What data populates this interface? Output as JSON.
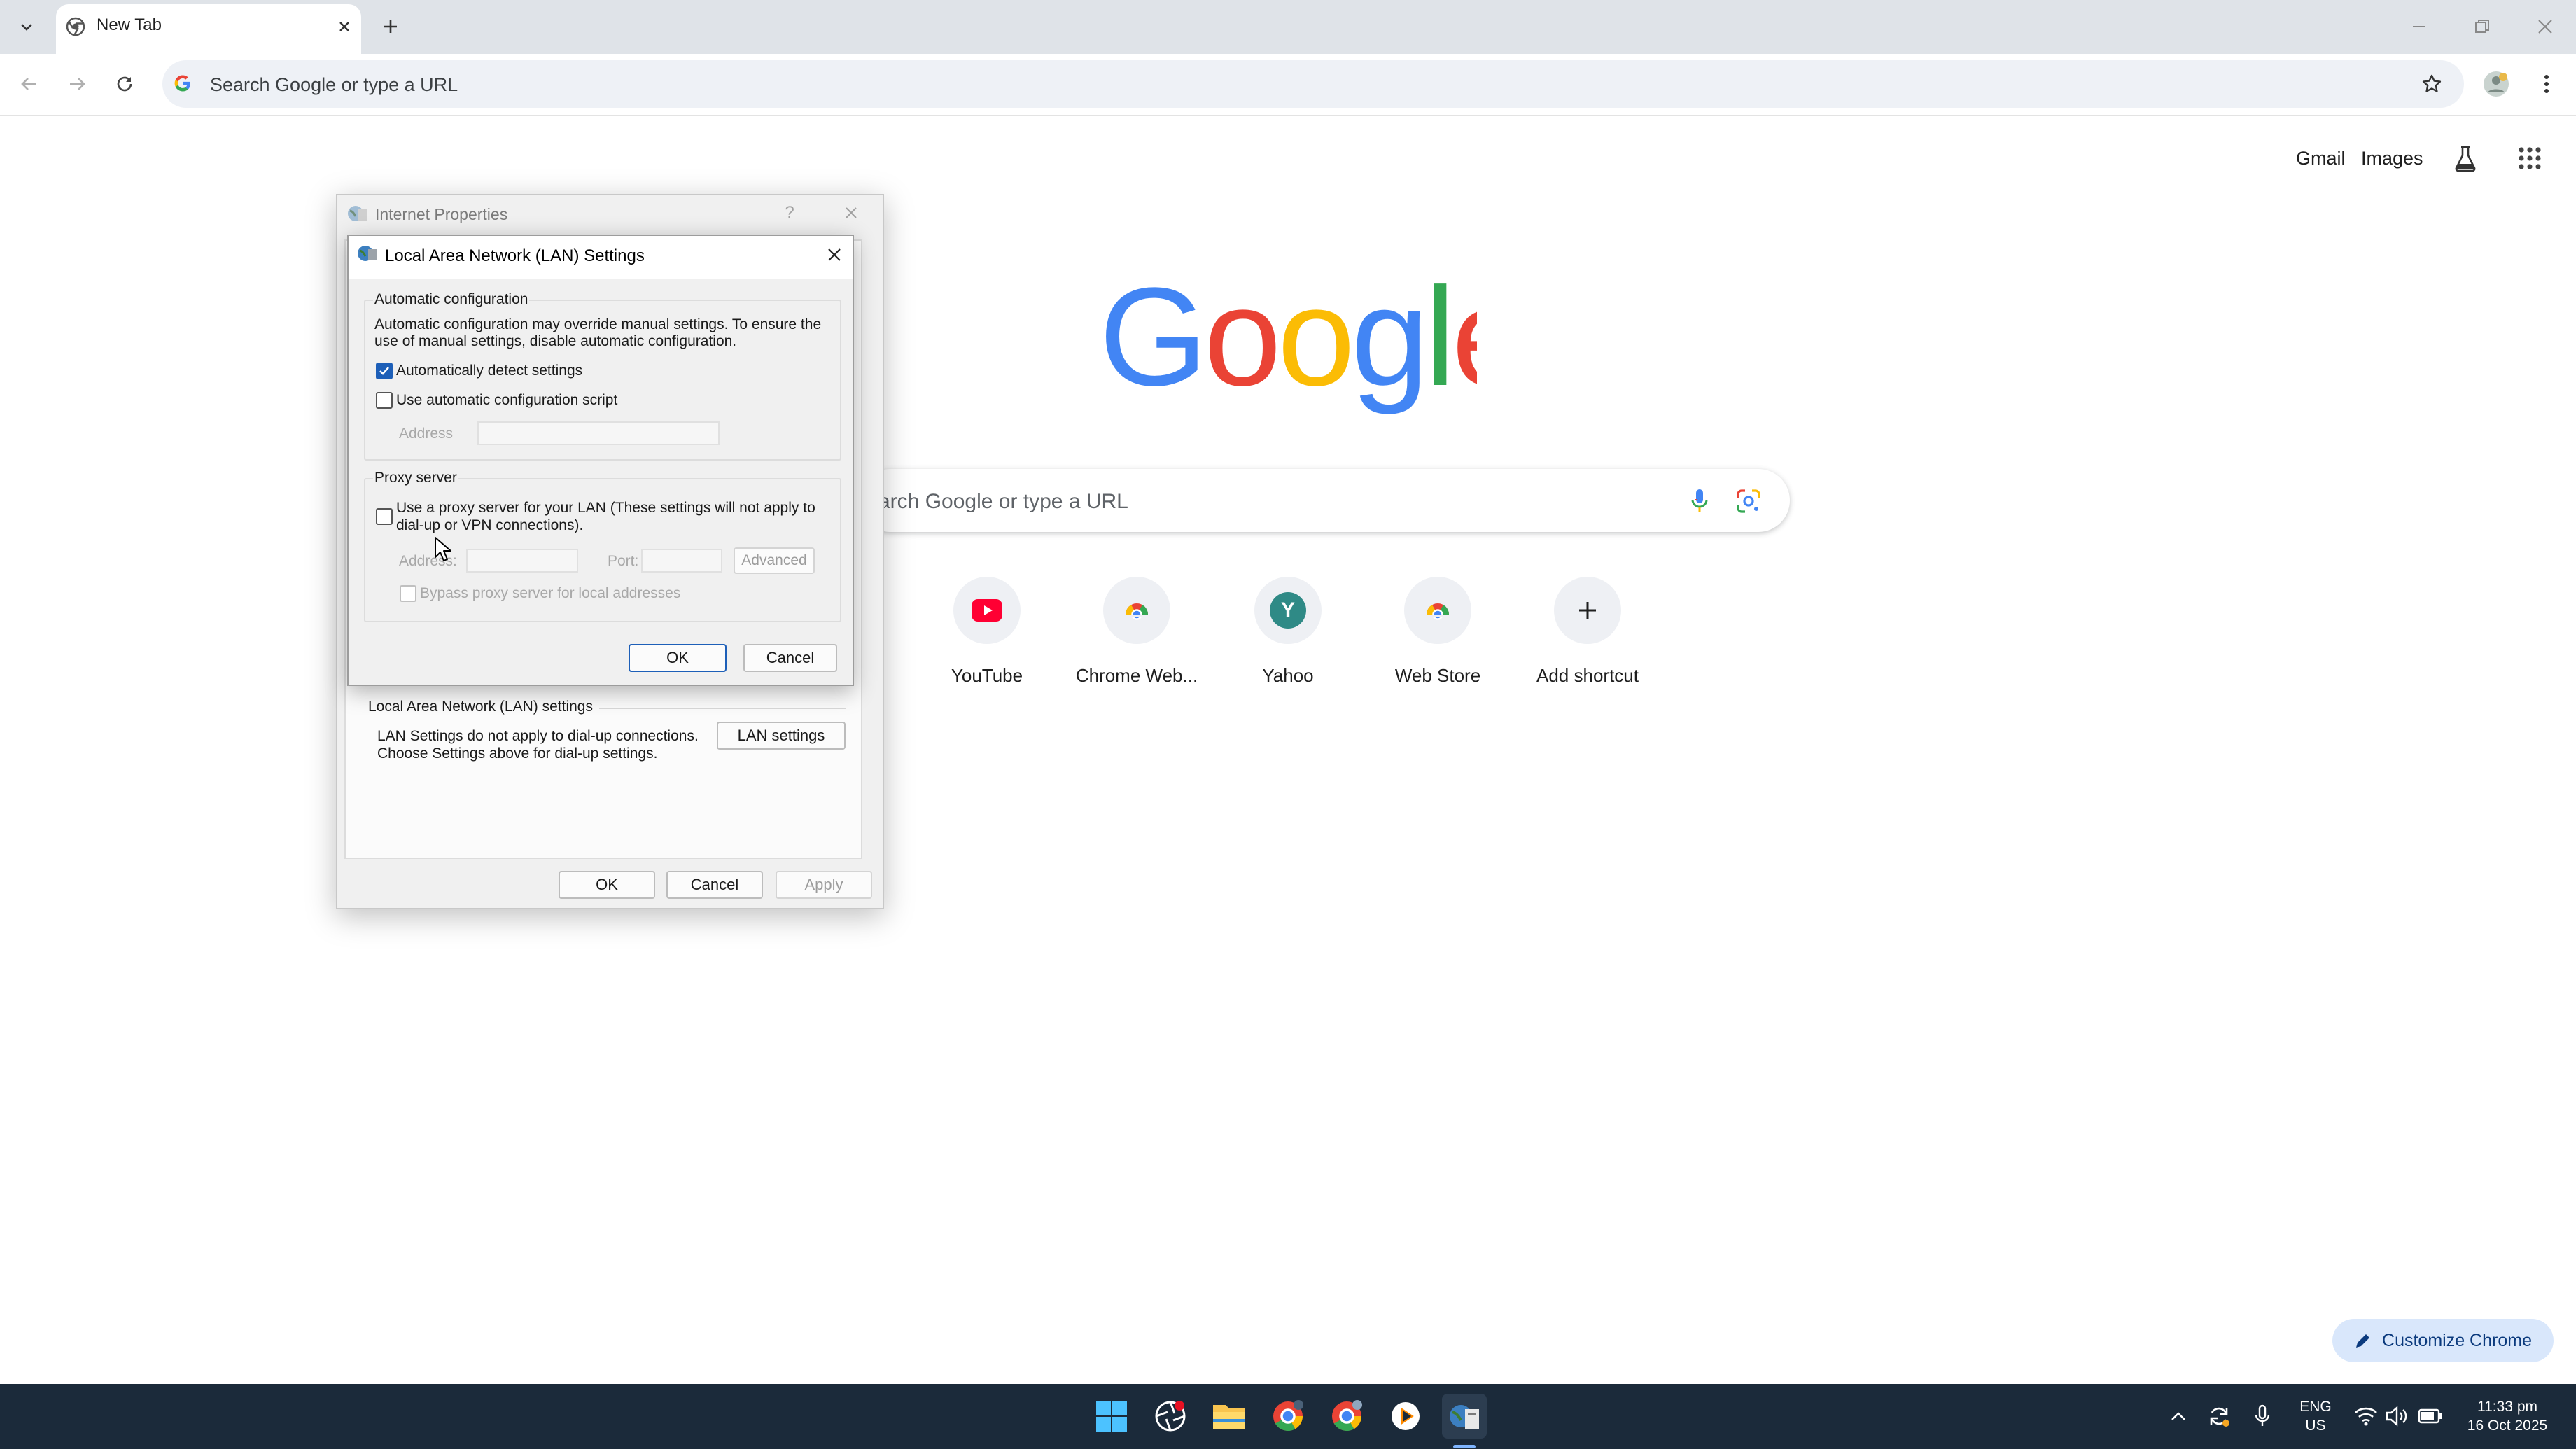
{
  "browser": {
    "tab_title": "New Tab",
    "omnibox_placeholder": "Search Google or type a URL"
  },
  "ntp": {
    "links": {
      "gmail": "Gmail",
      "images": "Images"
    },
    "logo": "Google",
    "search_placeholder": "arch Google or type a URL",
    "shortcuts": [
      {
        "label": "YouTube",
        "icon": "youtube-icon"
      },
      {
        "label": "Chrome Web...",
        "icon": "chrome-web-store-icon"
      },
      {
        "label": "Yahoo",
        "icon": "yahoo-icon",
        "letter": "Y"
      },
      {
        "label": "Web Store",
        "icon": "web-store-icon"
      },
      {
        "label": "Add shortcut",
        "icon": "plus-icon"
      }
    ],
    "customize_label": "Customize Chrome"
  },
  "internet_properties": {
    "title": "Internet Properties",
    "lan_section_title": "Local Area Network (LAN) settings",
    "lan_note_line1": "LAN Settings do not apply to dial-up connections.",
    "lan_note_line2": "Choose Settings above for dial-up settings.",
    "lan_settings_button": "LAN settings",
    "ok": "OK",
    "cancel": "Cancel",
    "apply": "Apply"
  },
  "lan_dialog": {
    "title": "Local Area Network (LAN) Settings",
    "auto_config": {
      "heading": "Automatic configuration",
      "desc_line1": "Automatic configuration may override manual settings.  To ensure the",
      "desc_line2": "use of manual settings, disable automatic configuration.",
      "auto_detect_label": "Automatically detect settings",
      "auto_detect_checked": true,
      "use_script_label": "Use automatic configuration script",
      "use_script_checked": false,
      "address_label": "Address"
    },
    "proxy": {
      "heading": "Proxy server",
      "use_proxy_line1": "Use a proxy server for your LAN (These settings will not apply to",
      "use_proxy_line2": "dial-up or VPN connections).",
      "use_proxy_checked": false,
      "address_label": "Address:",
      "port_label": "Port:",
      "advanced_button": "Advanced",
      "bypass_label": "Bypass proxy server for local addresses",
      "bypass_checked": false
    },
    "ok": "OK",
    "cancel": "Cancel"
  },
  "taskbar": {
    "lang_line1": "ENG",
    "lang_line2": "US",
    "time": "11:33 pm",
    "date": "16 Oct 2025"
  },
  "colors": {
    "google_blue": "#4285F4",
    "google_red": "#EA4335",
    "google_yellow": "#FBBC05",
    "google_green": "#34A853",
    "taskbar": "#1b2a3a",
    "accent": "#1d5fb8"
  }
}
